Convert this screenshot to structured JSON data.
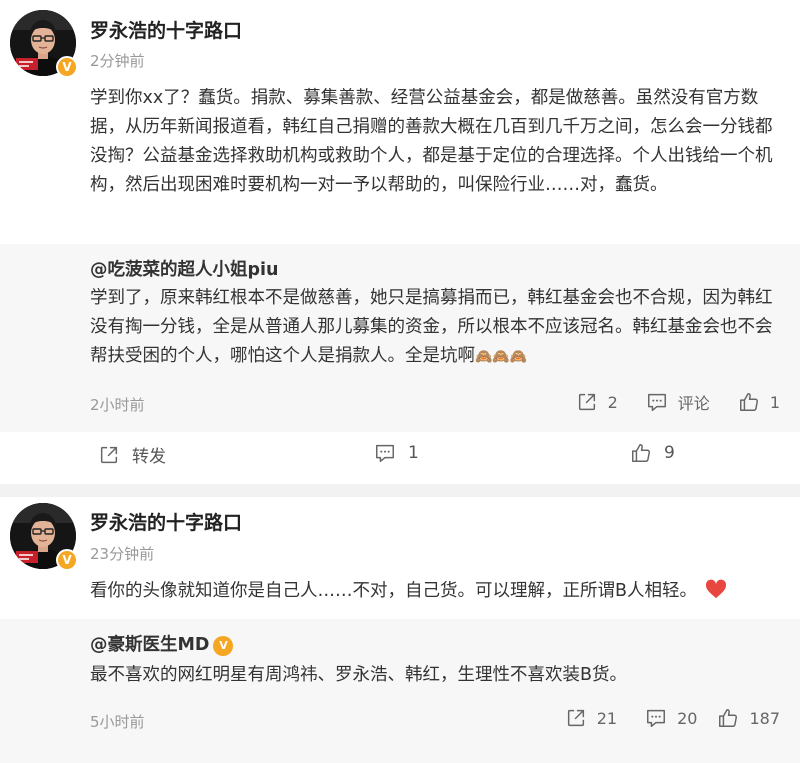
{
  "posts": [
    {
      "author": "罗永浩的十字路口",
      "verified_badge": "V",
      "time": "2分钟前",
      "content": "学到你xx了？蠢货。捐款、募集善款、经营公益基金会，都是做慈善。虽然没有官方数据，从历年新闻报道看，韩红自己捐赠的善款大概在几百到几千万之间，怎么会一分钱都没掏？公益基金选择救助机构或救助个人，都是基于定位的合理选择。个人出钱给一个机构，然后出现困难时要机构一对一予以帮助的，叫保险行业……对，蠢货。",
      "quote": {
        "author": "@吃菠菜的超人小姐piu",
        "text": "学到了，原来韩红根本不是做慈善，她只是搞募捐而已，韩红基金会也不合规，因为韩红没有掏一分钱，全是从普通人那儿募集的资金，所以根本不应该冠名。韩红基金会也不会帮扶受困的个人，哪怕这个人是捐款人。全是坑啊",
        "emoji": "🙈🙈🙈",
        "time": "2小时前",
        "repost_count": "2",
        "comment_label": "评论",
        "like_count": "1"
      },
      "repost_label": "转发",
      "comment_count": "1",
      "like_count": "9"
    },
    {
      "author": "罗永浩的十字路口",
      "verified_badge": "V",
      "time": "23分钟前",
      "content": "看你的头像就知道你是自己人……不对，自己货。可以理解，正所谓B人相轻。",
      "quote": {
        "author": "@豪斯医生MD",
        "badge": "V",
        "text": "最不喜欢的网红明星有周鸿祎、罗永浩、韩红，生理性不喜欢装B货。",
        "time": "5小时前",
        "repost_count": "21",
        "comment_count": "20",
        "like_count": "187"
      }
    }
  ],
  "colors": {
    "badge": "#f5a623",
    "heart": "#e8473f",
    "muted": "#999999"
  }
}
